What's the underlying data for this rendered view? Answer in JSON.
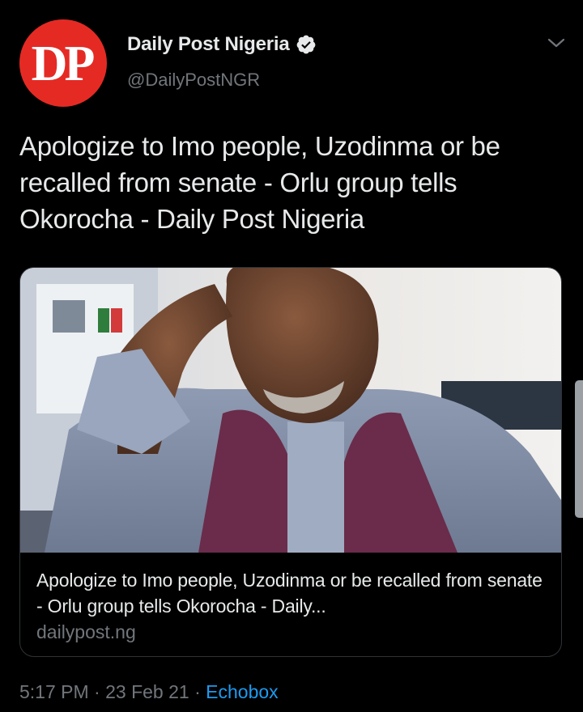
{
  "author": {
    "avatar_initials": "DP",
    "name": "Daily Post Nigeria",
    "handle": "@DailyPostNGR",
    "verified": true,
    "avatar_color": "#e52a24"
  },
  "tweet": {
    "text": "Apologize to Imo people, Uzodinma or be recalled from senate - Orlu group tells Okorocha - Daily Post Nigeria"
  },
  "card": {
    "image_icon": "news-photo",
    "title": "Apologize to Imo people, Uzodinma or be recalled from senate - Orlu group tells Okorocha - Daily...",
    "domain": "dailypost.ng"
  },
  "meta": {
    "time": "5:17 PM",
    "separator": " · ",
    "date": "23 Feb 21",
    "source": "Echobox"
  },
  "colors": {
    "background": "#000000",
    "text": "#e7e9ea",
    "secondary": "#71767b",
    "link": "#1d9bf0",
    "border": "#2f3336"
  }
}
